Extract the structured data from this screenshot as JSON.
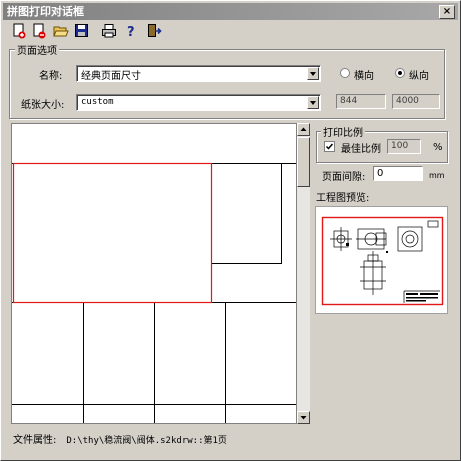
{
  "window": {
    "title": "拼图打印对话框",
    "close_label": "×"
  },
  "toolbar": {
    "icons": [
      "new-icon",
      "delete-icon",
      "open-folder-icon",
      "save-icon",
      "print-icon",
      "help-icon",
      "exit-icon"
    ]
  },
  "page_options": {
    "legend": "页面选项",
    "name_label": "名称:",
    "name_value": "经典页面尺寸",
    "size_label": "纸张大小:",
    "size_value": "custom",
    "orientation_landscape": "横向",
    "orientation_portrait": "纵向",
    "selected_orientation": "纵向",
    "width": "844",
    "height": "4000"
  },
  "print_scale": {
    "legend": "打印比例",
    "best_scale_label": "最佳比例",
    "best_scale_checked": true,
    "scale_value": "100",
    "percent": "%",
    "gap_label": "页面间隙:",
    "gap_value": "0",
    "gap_unit": "mm",
    "drawing_preview_label": "工程图预览:"
  },
  "status": {
    "label": "文件属性:",
    "path": "D:\\thy\\稳流阀\\阀体.s2kdrw::第1页"
  },
  "colors": {
    "page_highlight": "#e01818",
    "grid_line": "#000000"
  }
}
